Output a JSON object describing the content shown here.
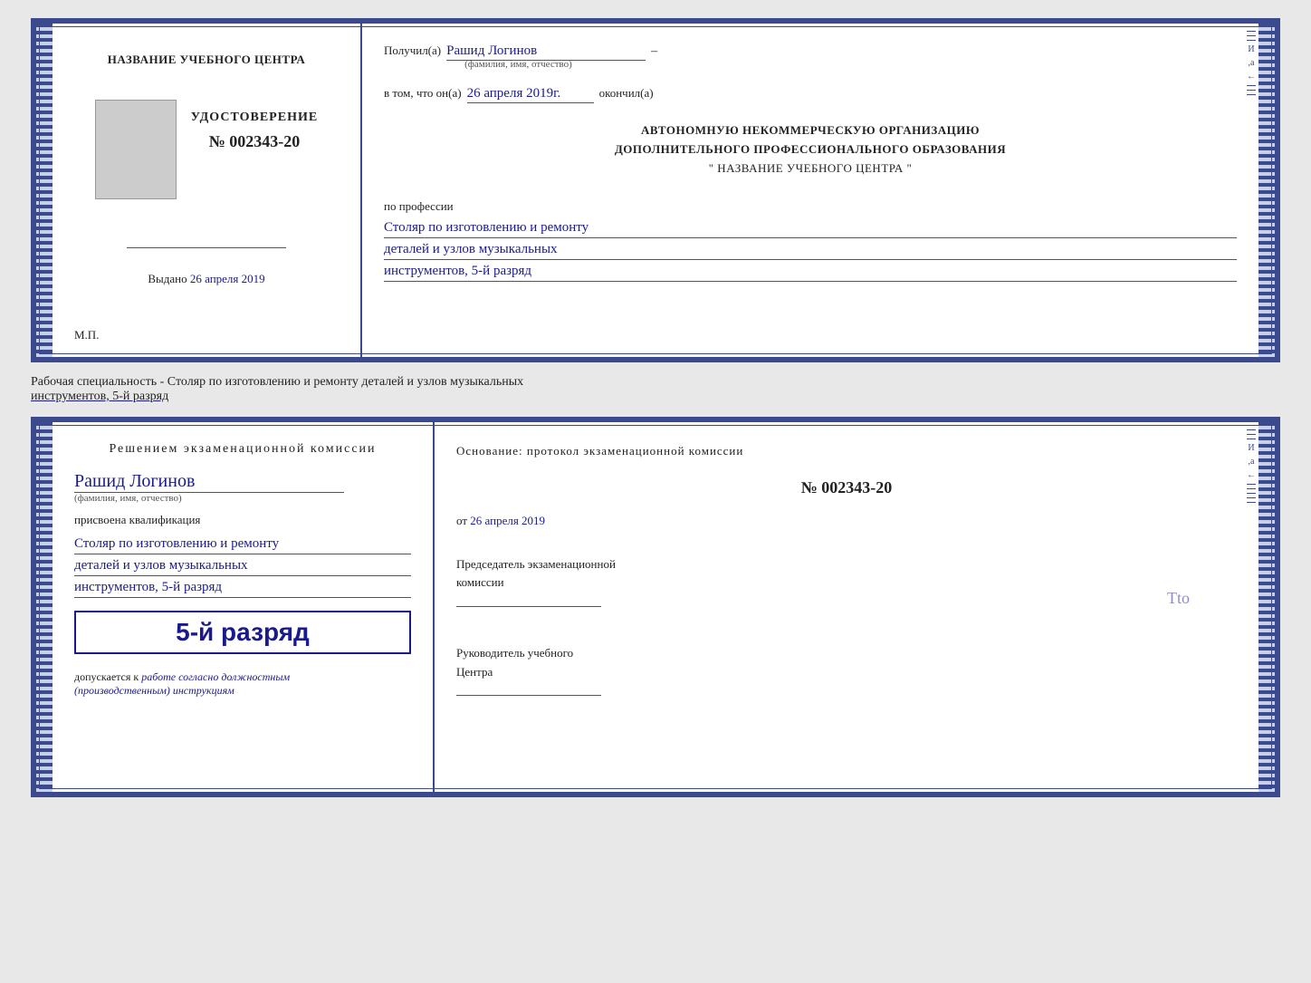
{
  "page": {
    "background_color": "#e8e8e8"
  },
  "top_cert": {
    "left": {
      "center_title": "НАЗВАНИЕ УЧЕБНОГО ЦЕНТРА",
      "udostoverenie_label": "УДОСТОВЕРЕНИЕ",
      "number_label": "№ 002343-20",
      "issued_label": "Выдано",
      "issued_date": "26 апреля 2019",
      "mp_label": "М.П."
    },
    "right": {
      "received_label": "Получил(а)",
      "person_name": "Рашид Логинов",
      "name_sublabel": "(фамилия, имя, отчество)",
      "dash": "–",
      "in_that_label": "в том, что он(а)",
      "completion_date": "26 апреля 2019г.",
      "finished_label": "окончил(а)",
      "org_line1": "АВТОНОМНУЮ НЕКОММЕРЧЕСКУЮ ОРГАНИЗАЦИЮ",
      "org_line2": "ДОПОЛНИТЕЛЬНОГО ПРОФЕССИОНАЛЬНОГО ОБРАЗОВАНИЯ",
      "org_line3": "\"  НАЗВАНИЕ УЧЕБНОГО ЦЕНТРА  \"",
      "profession_label": "по профессии",
      "profession_line1": "Столяр по изготовлению и ремонту",
      "profession_line2": "деталей и узлов музыкальных",
      "profession_line3": "инструментов, 5-й разряд"
    }
  },
  "specialty_label": {
    "text_prefix": "Рабочая специальность - Столяр по изготовлению и ремонту деталей и узлов музыкальных",
    "text_suffix": "инструментов, 5-й разряд"
  },
  "bottom_cert": {
    "left": {
      "decision_label": "Решением экзаменационной комиссии",
      "person_name": "Рашид Логинов",
      "name_sublabel": "(фамилия, имя, отчество)",
      "assigned_label": "присвоена квалификация",
      "qualification_line1": "Столяр по изготовлению и ремонту",
      "qualification_line2": "деталей и узлов музыкальных",
      "qualification_line3": "инструментов, 5-й разряд",
      "rank_label": "5-й разряд",
      "admission_prefix": "допускается к",
      "admission_value": "работе согласно должностным",
      "admission_suffix": "(производственным) инструкциям"
    },
    "right": {
      "basis_label": "Основание: протокол экзаменационной комиссии",
      "protocol_number": "№ 002343-20",
      "date_prefix": "от",
      "date_value": "26 апреля 2019",
      "chairman_line1": "Председатель экзаменационной",
      "chairman_line2": "комиссии",
      "head_line1": "Руководитель учебного",
      "head_line2": "Центра",
      "tto_mark": "Tto"
    }
  },
  "deco": {
    "right_chars": [
      "–",
      "–",
      "–",
      "И",
      "a",
      "←",
      "–",
      "–",
      "–",
      "–",
      "–"
    ]
  }
}
